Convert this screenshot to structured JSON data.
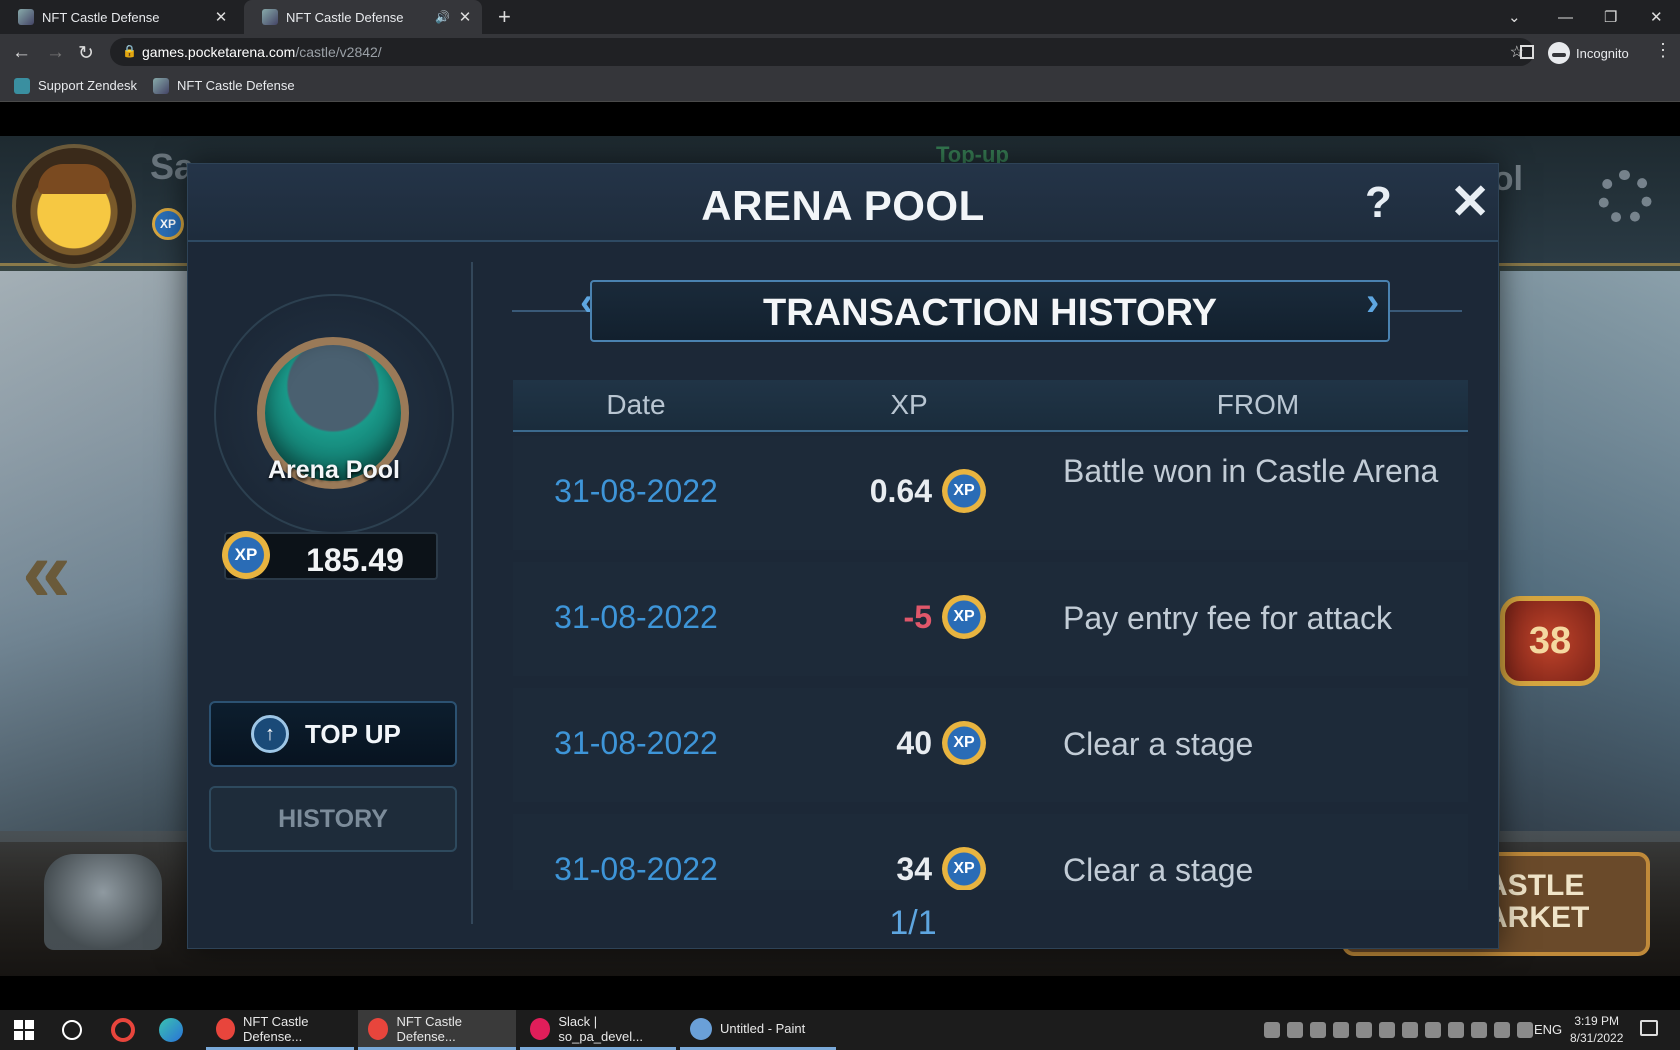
{
  "browser": {
    "tabs": [
      {
        "title": "NFT Castle Defense",
        "active": false
      },
      {
        "title": "NFT Castle Defense",
        "active": true
      }
    ],
    "url_host": "games.pocketarena.com",
    "url_path": "/castle/v2842/",
    "profile": "Incognito",
    "bookmarks": [
      "Support Zendesk",
      "NFT Castle Defense"
    ]
  },
  "game_bg": {
    "player_name_partial": "Sa",
    "topup_label_partial": "Top-up",
    "pool_label_partial": "ool",
    "level": "38",
    "market_label": "ASTLE\nARKET"
  },
  "modal": {
    "title": "ARENA POOL",
    "help": "?",
    "close": "✕",
    "pool_label": "Arena Pool",
    "balance": "185.49",
    "coin_label": "XP",
    "topup_label": "TOP UP",
    "history_label": "HISTORY",
    "section_title": "TRANSACTION HISTORY",
    "columns": {
      "date": "Date",
      "xp": "XP",
      "from": "FROM"
    },
    "transactions": [
      {
        "date": "31-08-2022",
        "xp": "0.64",
        "from": "Battle won in Castle Arena",
        "negative": false
      },
      {
        "date": "31-08-2022",
        "xp": "-5",
        "from": "Pay entry fee for attack",
        "negative": true
      },
      {
        "date": "31-08-2022",
        "xp": "40",
        "from": "Clear a stage",
        "negative": false
      },
      {
        "date": "31-08-2022",
        "xp": "34",
        "from": "Clear a stage",
        "negative": false
      }
    ],
    "page": "1/1"
  },
  "taskbar": {
    "apps": [
      {
        "label": "NFT Castle Defense...",
        "color": "#e8453c"
      },
      {
        "label": "NFT Castle Defense...",
        "color": "#e8453c"
      },
      {
        "label": "Slack | so_pa_devel...",
        "color": "#4a154b"
      },
      {
        "label": "Untitled - Paint",
        "color": "#6aa0d8"
      }
    ],
    "lang": "ENG",
    "time": "3:19 PM",
    "date": "8/31/2022"
  },
  "colors": {
    "accent": "#3e95d8",
    "negative": "#e0576a",
    "modal_bg": "#1c2837"
  }
}
